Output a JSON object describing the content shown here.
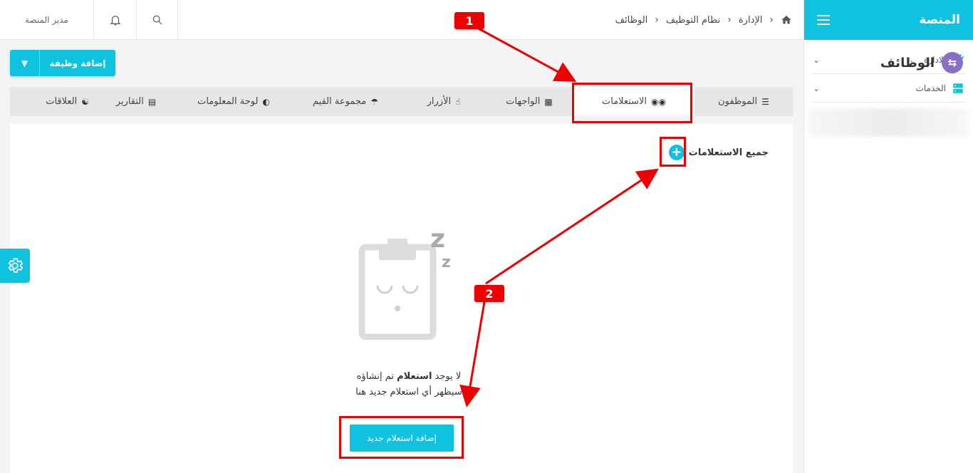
{
  "sidebar": {
    "title": "المنصة",
    "items": [
      {
        "label": "الادارة",
        "icon": "wrench-icon"
      },
      {
        "label": "الخدمات",
        "icon": "server-icon"
      }
    ]
  },
  "topbar": {
    "user": "مدير المنصة",
    "breadcrumbs": [
      "الإدارة",
      "نظام التوظيف",
      "الوظائف"
    ]
  },
  "page": {
    "title": "الوظائف",
    "add_button": "إضافة وظيفة"
  },
  "tabs": [
    {
      "label": "الموظفون",
      "icon": "list-icon"
    },
    {
      "label": "الاستعلامات",
      "icon": "binoculars-icon",
      "active": true
    },
    {
      "label": "الواجهات",
      "icon": "layout-icon"
    },
    {
      "label": "الأزرار",
      "icon": "pointer-icon"
    },
    {
      "label": "مجموعة القيم",
      "icon": "umbrella-icon"
    },
    {
      "label": "لوحة المعلومات",
      "icon": "pie-chart-icon"
    },
    {
      "label": "التقارير",
      "icon": "file-icon"
    },
    {
      "label": "العلاقات",
      "icon": "network-icon"
    }
  ],
  "content": {
    "section_title": "جميع الاستعلامات",
    "empty_prefix": "لا يوجد ",
    "empty_bold": "استعلام",
    "empty_suffix": " تم إنشاؤه",
    "empty_line2": "سيظهر أي استعلام جديد هنا",
    "add_new_button": "إضافة استعلام جديد"
  },
  "annotations": {
    "badge1": "1",
    "badge2": "2"
  },
  "colors": {
    "accent": "#0fc3e0",
    "title_icon": "#8a6fc7",
    "annotation": "#e00000"
  }
}
